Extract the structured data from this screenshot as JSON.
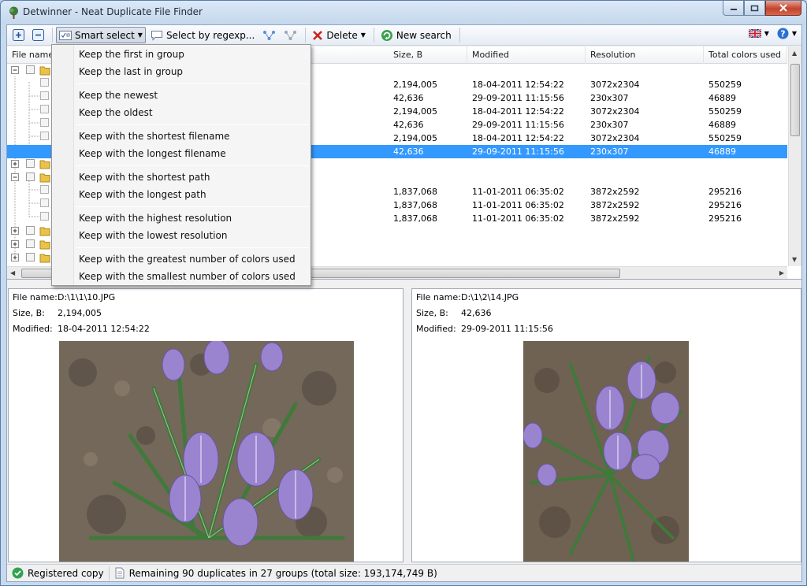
{
  "window": {
    "title": "Detwinner - Neat Duplicate File Finder"
  },
  "toolbar": {
    "smart_select": "Smart select",
    "select_by_regexp": "Select by regexp...",
    "delete": "Delete",
    "new_search": "New search"
  },
  "grid": {
    "columns": [
      "File name",
      "Size, B",
      "Modified",
      "Resolution",
      "Total colors used"
    ],
    "rows": [
      {
        "size": "2,194,005",
        "modified": "18-04-2011 12:54:22",
        "resolution": "3072x2304",
        "colors": "550259"
      },
      {
        "size": "42,636",
        "modified": "29-09-2011 11:15:56",
        "resolution": "230x307",
        "colors": "46889"
      },
      {
        "size": "2,194,005",
        "modified": "18-04-2011 12:54:22",
        "resolution": "3072x2304",
        "colors": "550259"
      },
      {
        "size": "42,636",
        "modified": "29-09-2011 11:15:56",
        "resolution": "230x307",
        "colors": "46889"
      },
      {
        "size": "2,194,005",
        "modified": "18-04-2011 12:54:22",
        "resolution": "3072x2304",
        "colors": "550259"
      },
      {
        "size": "42,636",
        "modified": "29-09-2011 11:15:56",
        "resolution": "230x307",
        "colors": "46889"
      },
      {
        "size": "1,837,068",
        "modified": "11-01-2011 06:35:02",
        "resolution": "3872x2592",
        "colors": "295216"
      },
      {
        "size": "1,837,068",
        "modified": "11-01-2011 06:35:02",
        "resolution": "3872x2592",
        "colors": "295216"
      },
      {
        "size": "1,837,068",
        "modified": "11-01-2011 06:35:02",
        "resolution": "3872x2592",
        "colors": "295216"
      }
    ]
  },
  "smart_menu": {
    "items": [
      "Keep the first in group",
      "Keep the last in group",
      "Keep the newest",
      "Keep the oldest",
      "Keep with the shortest filename",
      "Keep with the longest filename",
      "Keep with the shortest path",
      "Keep with the longest path",
      "Keep with the highest resolution",
      "Keep with the lowest resolution",
      "Keep with the greatest number of colors used",
      "Keep with the smallest number of colors used"
    ]
  },
  "preview_left": {
    "file_name_label": "File name:",
    "file_name": "D:\\1\\1\\10.JPG",
    "size_label": "Size, B:",
    "size": "2,194,005",
    "modified_label": "Modified:",
    "modified": "18-04-2011 12:54:22"
  },
  "preview_right": {
    "file_name_label": "File name:",
    "file_name": "D:\\1\\2\\14.JPG",
    "size_label": "Size, B:",
    "size": "42,636",
    "modified_label": "Modified:",
    "modified": "29-09-2011 11:15:56"
  },
  "status": {
    "registered": "Registered copy",
    "remaining": "Remaining 90 duplicates in 27 groups (total size: 193,174,749 B)"
  },
  "colors": {
    "selection": "#3399ff",
    "folder": "#e8c249",
    "crocus_petal": "#9a84cf",
    "soil": "#6f6253"
  }
}
